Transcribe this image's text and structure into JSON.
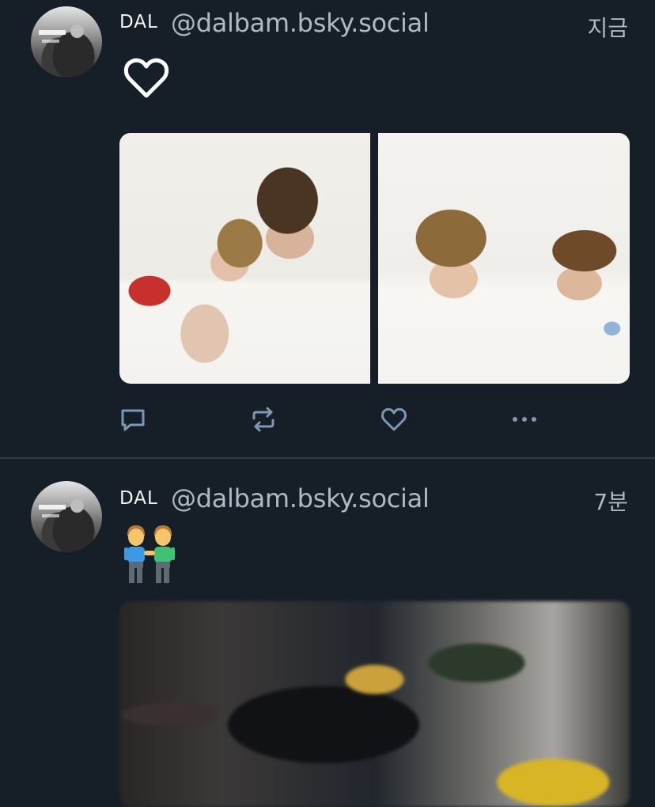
{
  "posts": [
    {
      "author_name": "DAL",
      "handle": "@dalbam.bsky.social",
      "time": "지금",
      "avatar_icon": "profile-avatar",
      "content_icon": "heart-outline-icon",
      "images": [
        "photo-left",
        "photo-right"
      ],
      "actions": [
        "reply-icon",
        "repost-icon",
        "like-icon",
        "more-icon"
      ]
    },
    {
      "author_name": "DAL",
      "handle": "@dalbam.bsky.social",
      "time": "7분",
      "avatar_icon": "profile-avatar",
      "content_emoji": "👬",
      "media": "video-thumbnail"
    }
  ],
  "colors": {
    "background": "#161e27",
    "divider": "#2e3b47",
    "secondary_text": "#aeb9c4",
    "action_icon": "#7b98b4"
  }
}
